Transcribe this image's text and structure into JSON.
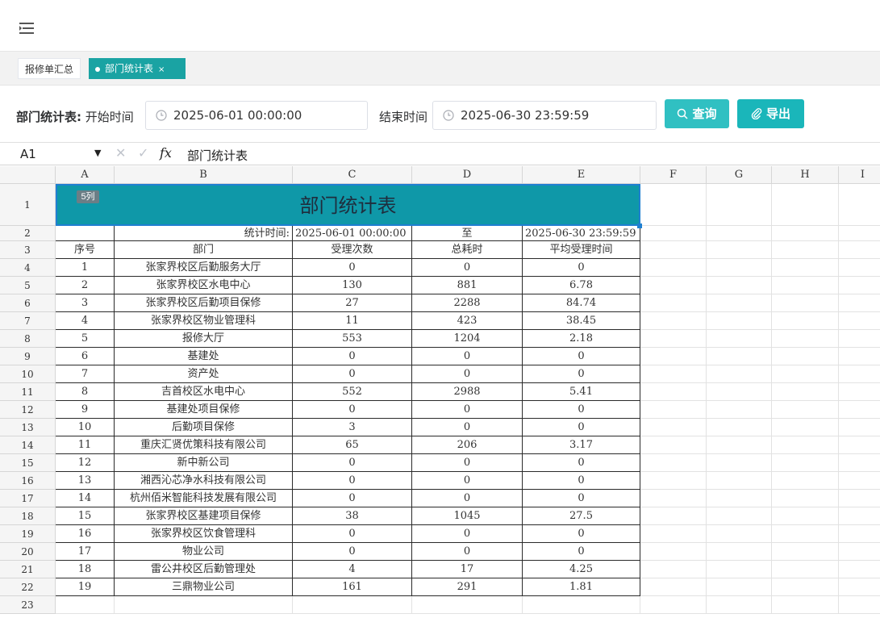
{
  "header": {
    "menu_icon": "menu-collapse-icon"
  },
  "tabs": [
    {
      "label": "报修单汇总"
    },
    {
      "label": "部门统计表",
      "close": "×"
    }
  ],
  "filter": {
    "page_label": "部门统计表:",
    "start_label": "开始时间",
    "start_value": "2025-06-01 00:00:00",
    "end_label": "结束时间",
    "end_value": "2025-06-30 23:59:59",
    "query_label": "查询",
    "export_label": "导出"
  },
  "formula_bar": {
    "cell_ref": "A1",
    "fx": "fx",
    "content": "部门统计表"
  },
  "sheet": {
    "columns": [
      "A",
      "B",
      "C",
      "D",
      "E",
      "F",
      "G",
      "H",
      "I"
    ],
    "title": "部门统计表",
    "badge": "5列",
    "stat_row": [
      "",
      "统计时间:",
      "2025-06-01 00:00:00",
      "至",
      "2025-06-30 23:59:59"
    ],
    "header_row": [
      "序号",
      "部门",
      "受理次数",
      "总耗时",
      "平均受理时间"
    ],
    "rows": [
      [
        "1",
        "张家界校区后勤服务大厅",
        "0",
        "0",
        "0"
      ],
      [
        "2",
        "张家界校区水电中心",
        "130",
        "881",
        "6.78"
      ],
      [
        "3",
        "张家界校区后勤项目保修",
        "27",
        "2288",
        "84.74"
      ],
      [
        "4",
        "张家界校区物业管理科",
        "11",
        "423",
        "38.45"
      ],
      [
        "5",
        "报修大厅",
        "553",
        "1204",
        "2.18"
      ],
      [
        "6",
        "基建处",
        "0",
        "0",
        "0"
      ],
      [
        "7",
        "资产处",
        "0",
        "0",
        "0"
      ],
      [
        "8",
        "吉首校区水电中心",
        "552",
        "2988",
        "5.41"
      ],
      [
        "9",
        "基建处项目保修",
        "0",
        "0",
        "0"
      ],
      [
        "10",
        "后勤项目保修",
        "3",
        "0",
        "0"
      ],
      [
        "11",
        "重庆汇贤优策科技有限公司",
        "65",
        "206",
        "3.17"
      ],
      [
        "12",
        "新中新公司",
        "0",
        "0",
        "0"
      ],
      [
        "13",
        "湘西沁芯净水科技有限公司",
        "0",
        "0",
        "0"
      ],
      [
        "14",
        "杭州佰米智能科技发展有限公司",
        "0",
        "0",
        "0"
      ],
      [
        "15",
        "张家界校区基建项目保修",
        "38",
        "1045",
        "27.5"
      ],
      [
        "16",
        "张家界校区饮食管理科",
        "0",
        "0",
        "0"
      ],
      [
        "17",
        "物业公司",
        "0",
        "0",
        "0"
      ],
      [
        "18",
        "雷公井校区后勤管理处",
        "4",
        "17",
        "4.25"
      ],
      [
        "19",
        "三鼎物业公司",
        "161",
        "291",
        "1.81"
      ]
    ],
    "row_numbers": [
      "1",
      "2",
      "3",
      "4",
      "5",
      "6",
      "7",
      "8",
      "9",
      "10",
      "11",
      "12",
      "13",
      "14",
      "15",
      "16",
      "17",
      "18",
      "19",
      "20",
      "21",
      "22",
      "23"
    ]
  }
}
